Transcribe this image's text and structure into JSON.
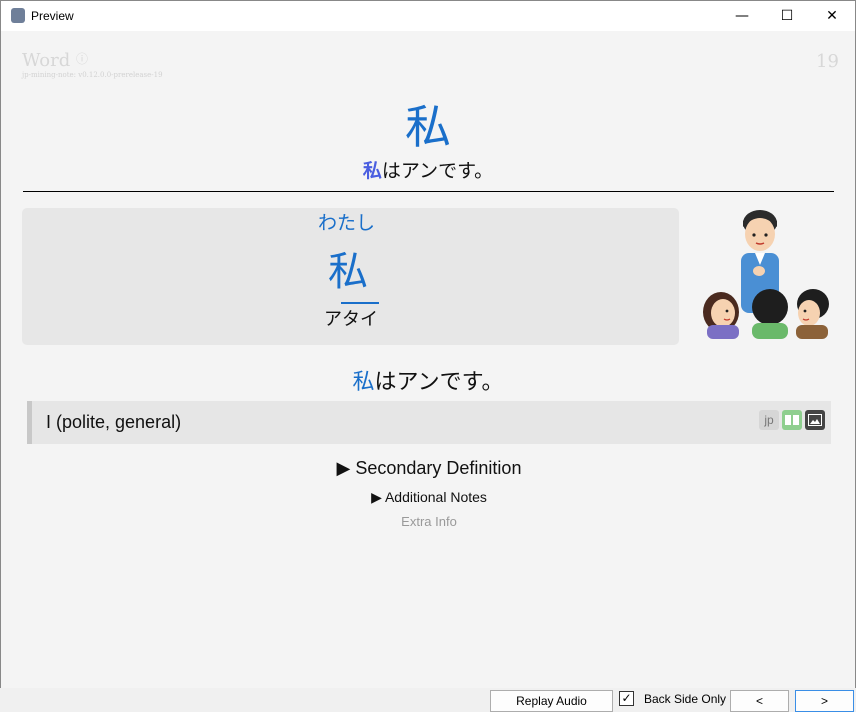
{
  "window": {
    "title": "Preview",
    "minimize_glyph": "—",
    "maximize_glyph": "☐",
    "close_glyph": "✕"
  },
  "card": {
    "note_type": "Word",
    "info_glyph": "ⓘ",
    "version": "jp-mining-note: v0.12.0.0-prerelease-19",
    "card_number": "19",
    "word": "私",
    "sentence_top": {
      "highlight": "私",
      "rest": "はアンです。"
    },
    "reading": {
      "furigana": "わたし",
      "kanji": "私",
      "katakana": "アタイ"
    },
    "illustration_name": "people-illustration",
    "sentence_mid": {
      "highlight": "私",
      "rest": "はアンです。"
    },
    "definition": "I (polite, general)",
    "tags": {
      "jp": "jp"
    },
    "secondary_definition": "▶ Secondary Definition",
    "additional_notes": "▶ Additional Notes",
    "extra_info": "Extra Info"
  },
  "footer": {
    "replay_audio": "Replay Audio",
    "back_side_only": "Back Side Only",
    "back_side_only_checked": true,
    "check_glyph": "✓",
    "prev": "<",
    "next": ">"
  },
  "colors": {
    "accent_blue": "#1a6fca",
    "highlight_purple": "#4a5ee0"
  }
}
